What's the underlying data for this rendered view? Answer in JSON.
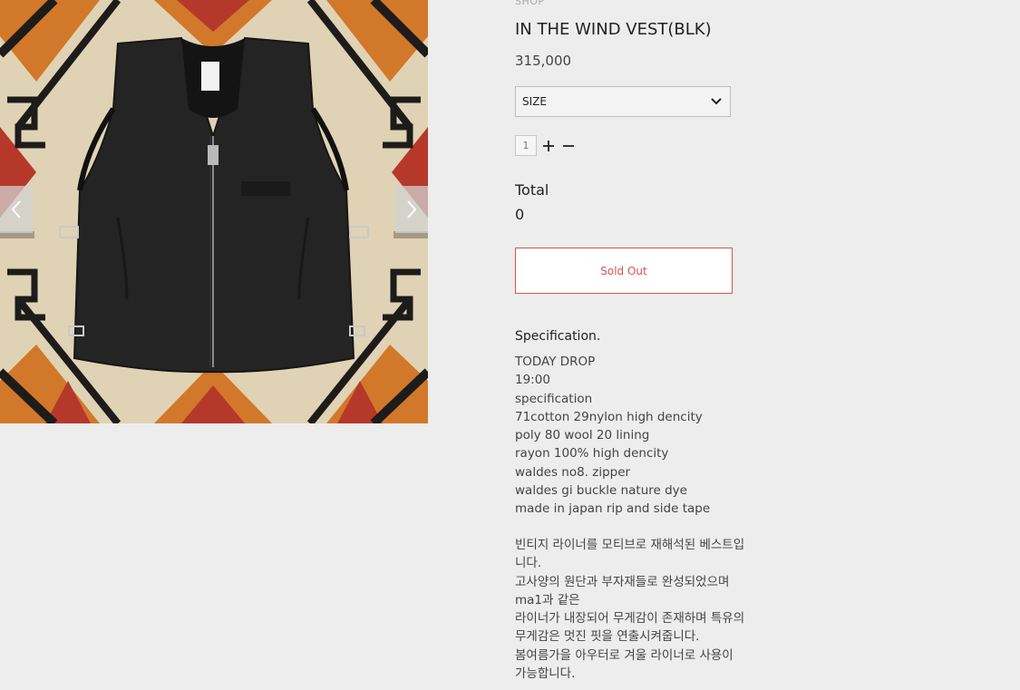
{
  "breadcrumb": "SHOP",
  "product": {
    "title": "IN THE WIND VEST(BLK)",
    "price": "315,000",
    "image_label": "vest-product-photo"
  },
  "size_select": {
    "selected": "SIZE"
  },
  "quantity": {
    "value": "1"
  },
  "total": {
    "label": "Total",
    "value": "0"
  },
  "buttons": {
    "sold_out": "Sold Out"
  },
  "specification": {
    "title": "Specification.",
    "lines": [
      "TODAY DROP",
      "19:00",
      "specification",
      "71cotton 29nylon high dencity",
      "poly 80 wool 20 lining",
      "rayon 100% high dencity",
      "waldes no8. zipper",
      "waldes gi buckle nature dye",
      "made in japan rip and side tape"
    ]
  },
  "description": {
    "lines": [
      "빈티지 라이너를 모티브로 재해석된 베스트입",
      "니다.",
      "고사양의 원단과 부자재들로 완성되었으며",
      "ma1과 같은",
      "라이너가 내장되어 무게감이 존재하며 특유의",
      "무게감은 멋진 핏을 연출시켜줍니다.",
      "봄여름가을 아우터로 겨울 라이너로 사용이",
      "가능합니다."
    ]
  },
  "colors": {
    "background": "#ededed",
    "soldout_accent": "#d9534f",
    "rug_orange": "#d2782a",
    "rug_red": "#b5382b",
    "rug_cream": "#e3d6bb",
    "rug_black": "#1e1c1a",
    "vest_black": "#242424"
  },
  "icons": {
    "prev": "chevron-left-icon",
    "next": "chevron-right-icon",
    "dropdown": "chevron-down-icon",
    "plus": "plus-icon",
    "minus": "minus-icon"
  }
}
